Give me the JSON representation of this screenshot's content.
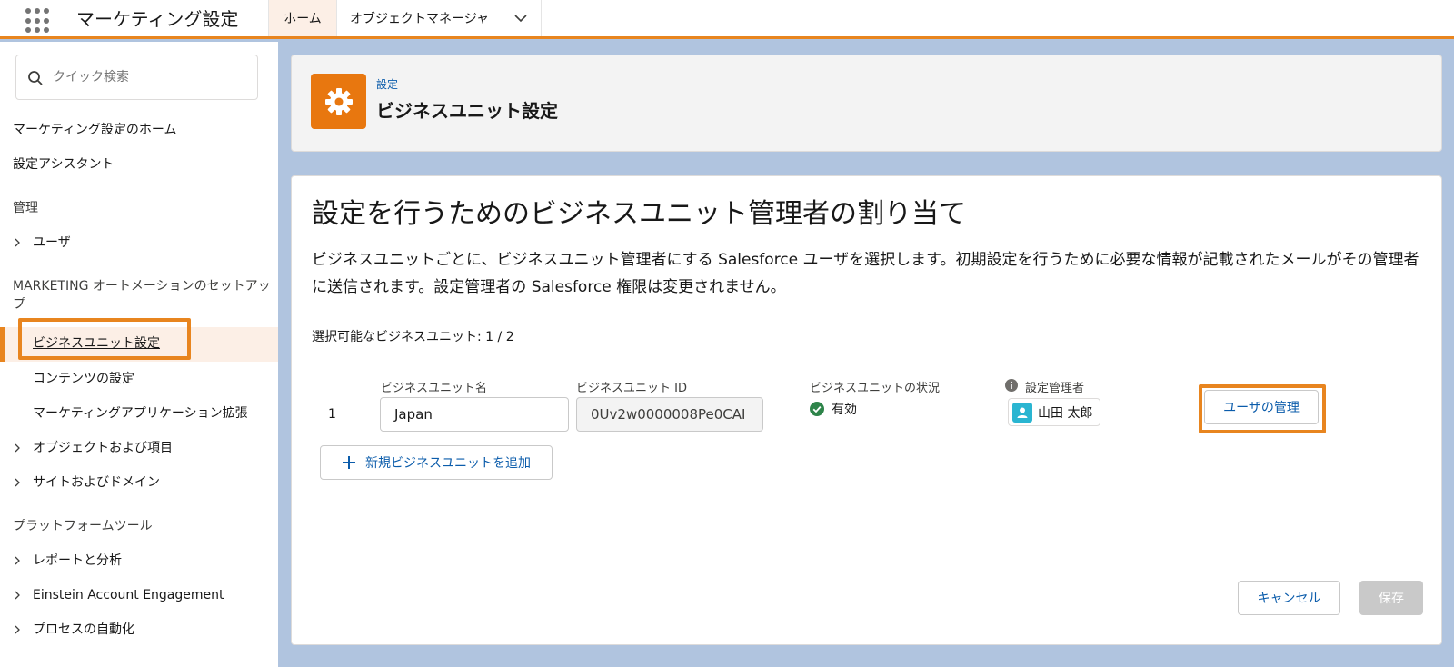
{
  "topbar": {
    "app_title": "マーケティング設定",
    "tab_home": "ホーム",
    "tab_object_manager": "オブジェクトマネージャ"
  },
  "sidebar": {
    "search_placeholder": "クイック検索",
    "items": [
      {
        "label": "マーケティング設定のホーム"
      },
      {
        "label": "設定アシスタント"
      }
    ],
    "section_admin": "管理",
    "users": "ユーザ",
    "section_marketing": "MARKETING オートメーションのセットアップ",
    "business_unit_setup": "ビジネスユニット設定",
    "content_setup": "コンテンツの設定",
    "marketing_app_ext": "マーケティングアプリケーション拡張",
    "objects_fields": "オブジェクトおよび項目",
    "sites_domains": "サイトおよびドメイン",
    "section_platform": "プラットフォームツール",
    "reports_analytics": "レポートと分析",
    "einstein": "Einstein Account Engagement",
    "process_automation": "プロセスの自動化"
  },
  "header": {
    "eyebrow": "設定",
    "title": "ビジネスユニット設定",
    "icon": "gear-icon"
  },
  "main": {
    "title": "設定を行うためのビジネスユニット管理者の割り当て",
    "description": "ビジネスユニットごとに、ビジネスユニット管理者にする Salesforce ユーザを選択します。初期設定を行うために必要な情報が記載されたメールがその管理者に送信されます。設定管理者の Salesforce 権限は変更されません。",
    "count_label": "選択可能なビジネスユニット: 1 / 2",
    "columns": {
      "name": "ビジネスユニット名",
      "id": "ビジネスユニット ID",
      "status": "ビジネスユニットの状況",
      "admin": "設定管理者"
    },
    "row": {
      "number": "1",
      "name": "Japan",
      "id": "0Uv2w0000008Pe0CAI",
      "status": "有効",
      "admin": "山田 太郎"
    },
    "manage_users_button": "ユーザの管理",
    "add_button": "新規ビジネスユニットを追加",
    "cancel_button": "キャンセル",
    "save_button": "保存"
  },
  "colors": {
    "accent": "#e8851f",
    "link": "#0b5cab",
    "status_ok": "#2e844a",
    "avatar": "#2ab5d1"
  }
}
